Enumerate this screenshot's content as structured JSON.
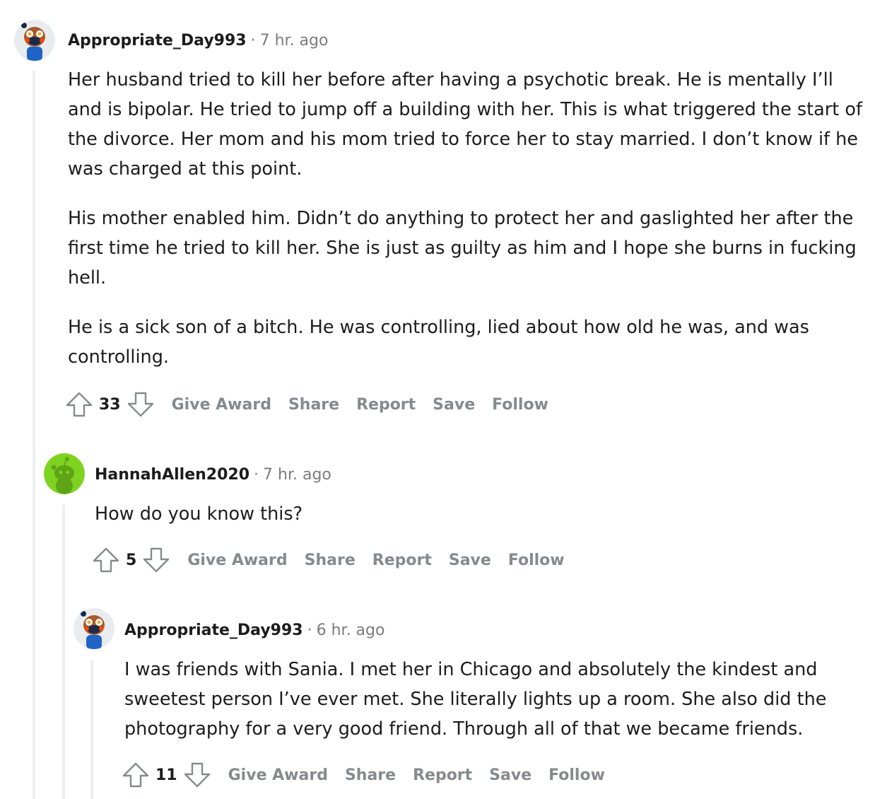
{
  "comments": [
    {
      "username": "Appropriate_Day993",
      "time": "7 hr. ago",
      "paragraphs": [
        "Her husband tried to kill her before after having a psychotic break. He is mentally I’ll and is bipolar. He tried to jump off a building with her. This is what triggered the start of the divorce. Her mom and his mom tried to force her to stay married. I don’t know if he was charged at this point.",
        "His mother enabled him. Didn’t do anything to protect her and gaslighted her after the first time he tried to kill her. She is just as guilty as him and I hope she burns in fucking hell.",
        "He is a sick son of a bitch. He was controlling, lied about how old he was, and was controlling."
      ],
      "score": "33",
      "avatar_icon": "snoo-owl-avatar-icon"
    },
    {
      "username": "HannahAllen2020",
      "time": "7 hr. ago",
      "paragraphs": [
        "How do you know this?"
      ],
      "score": "5",
      "avatar_icon": "snoo-default-green-avatar-icon"
    },
    {
      "username": "Appropriate_Day993",
      "time": "6 hr. ago",
      "paragraphs": [
        "I was friends with Sania. I met her in Chicago and absolutely the kindest and sweetest person I’ve ever met. She literally lights up a room. She also did the photography for a very good friend. Through all of that we became friends."
      ],
      "score": "11",
      "avatar_icon": "snoo-owl-avatar-icon"
    }
  ],
  "separator": "·",
  "actions": {
    "give_award": "Give Award",
    "share": "Share",
    "report": "Report",
    "save": "Save",
    "follow": "Follow"
  },
  "icons": {
    "upvote": "upvote-arrow-icon",
    "downvote": "downvote-arrow-icon"
  },
  "colors": {
    "text": "#1c1c1c",
    "muted": "#7c7c7c",
    "action": "#878a8c",
    "thread_line": "#edeff1",
    "green_avatar_bg": "#7ed321"
  }
}
